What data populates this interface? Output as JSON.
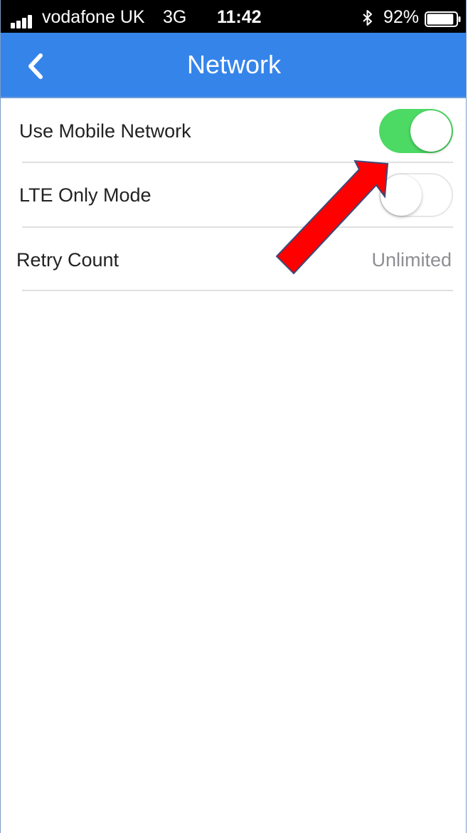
{
  "status_bar": {
    "carrier": "vodafone UK",
    "network_type": "3G",
    "time": "11:42",
    "battery_percent": "92%",
    "battery_level": 0.92
  },
  "nav": {
    "title": "Network",
    "back_icon": "chevron-left-icon"
  },
  "settings": [
    {
      "label": "Use Mobile Network",
      "control": "toggle",
      "on": true
    },
    {
      "label": "LTE Only Mode",
      "control": "toggle",
      "on": false
    },
    {
      "label": "Retry Count",
      "control": "value",
      "value": "Unlimited"
    }
  ],
  "colors": {
    "nav_background": "#3584ea",
    "toggle_on": "#4cd964",
    "annotation_arrow": "#ff0000"
  },
  "annotation": {
    "type": "arrow",
    "points_to": "Use Mobile Network toggle"
  }
}
